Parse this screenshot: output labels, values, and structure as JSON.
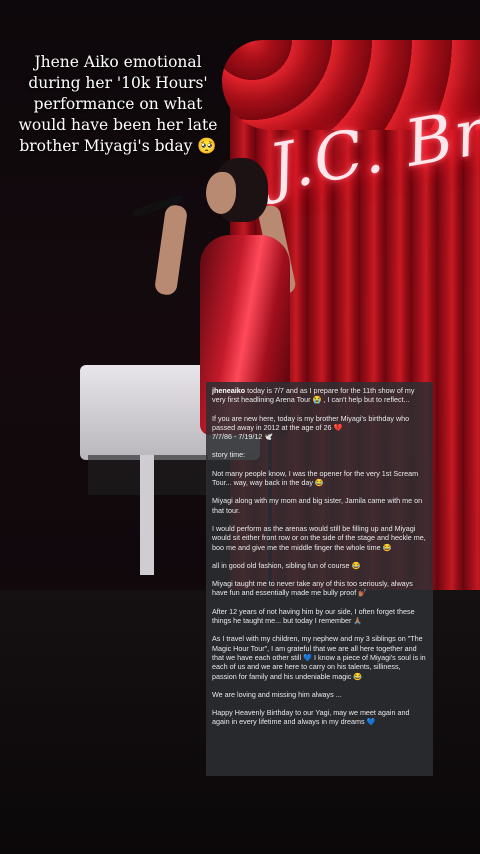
{
  "overlay_title": "Jhene Aiko emotional during her '10k Hours' performance on what would have been her late brother Miyagi's bday 🥺",
  "neon_sign": "J.C. Bro",
  "post": {
    "username": "jheneaiko",
    "p1": " today is 7/7 and as I prepare for the 11th show of my very first headlining Arena Tour 😭 , I can't help but to reflect...",
    "p2a": "If you are new here, today is my brother Miyagi's birthday who passed away in 2012 at the age of 26 💔",
    "p2b": "7/7/86 - 7/19/12 🕊️",
    "p3": "story time:",
    "p4": "Not many people know,  I was the opener for the very 1st Scream Tour... way, way back in the day 😂",
    "p5": "Miyagi along with my mom and big sister, Jamila came with me on that tour.",
    "p6": "I would perform as the arenas would still be filling up and Miyagi would sit either front row or on the side of the stage and heckle me, boo me and give me the middle finger the whole time 😂",
    "p7": "all in good old fashion, sibling fun of course 😂",
    "p8": "Miyagi taught me to never take any of this too seriously, always have fun and essentially made me bully proof 💅🏽",
    "p9": "After 12 years of not having him by our side, I often forget these things he taught me... but today I remember 🙏🏽",
    "p10": "As I travel with my children, my nephew and my 3 siblings on \"The Magic Hour Tour\", I am grateful that we are all here together and that we have each other still 💙  I know a piece of Miyagi's soul is in each of us and we are here to carry on his talents, silliness, passion for family and his undeniable magic 😂",
    "p11": "We are loving and missing him always ...",
    "p12": "Happy Heavenly Birthday to our Yagi, may we meet again and again in every lifetime and always in my dreams 💙"
  }
}
